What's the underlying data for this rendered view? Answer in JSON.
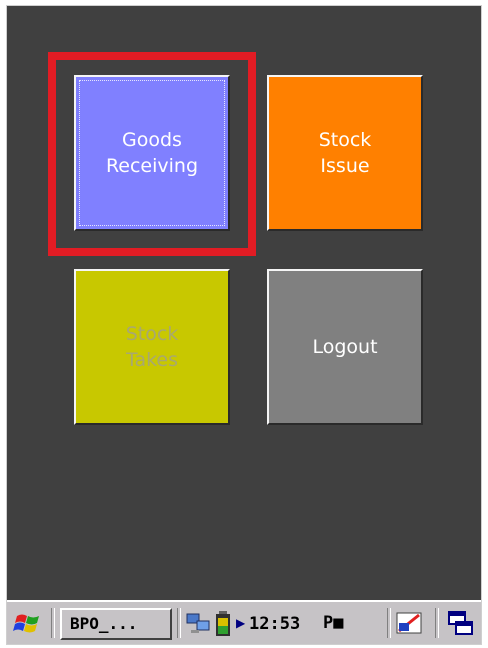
{
  "tiles": [
    {
      "id": "goods",
      "label": "Goods\nReceiving",
      "color": "#8080ff",
      "enabled": true,
      "focused": true
    },
    {
      "id": "stock-issue",
      "label": "Stock\nIssue",
      "color": "#ff8000",
      "enabled": true
    },
    {
      "id": "stock-takes",
      "label": "Stock\nTakes",
      "color": "#c8c800",
      "enabled": false
    },
    {
      "id": "logout",
      "label": "Logout",
      "color": "#808080",
      "enabled": true
    }
  ],
  "highlight_color": "#e21c24",
  "taskbar": {
    "start_icon": "windows-flag-icon",
    "task_button_label": "BPO_...",
    "tray_icons": [
      "network-icon",
      "battery-icon"
    ],
    "clock": "12:53",
    "clock_suffix": "P■",
    "input_panel_icon": "input-panel-icon",
    "desktop_switch_icon": "desktop-switch-icon"
  }
}
